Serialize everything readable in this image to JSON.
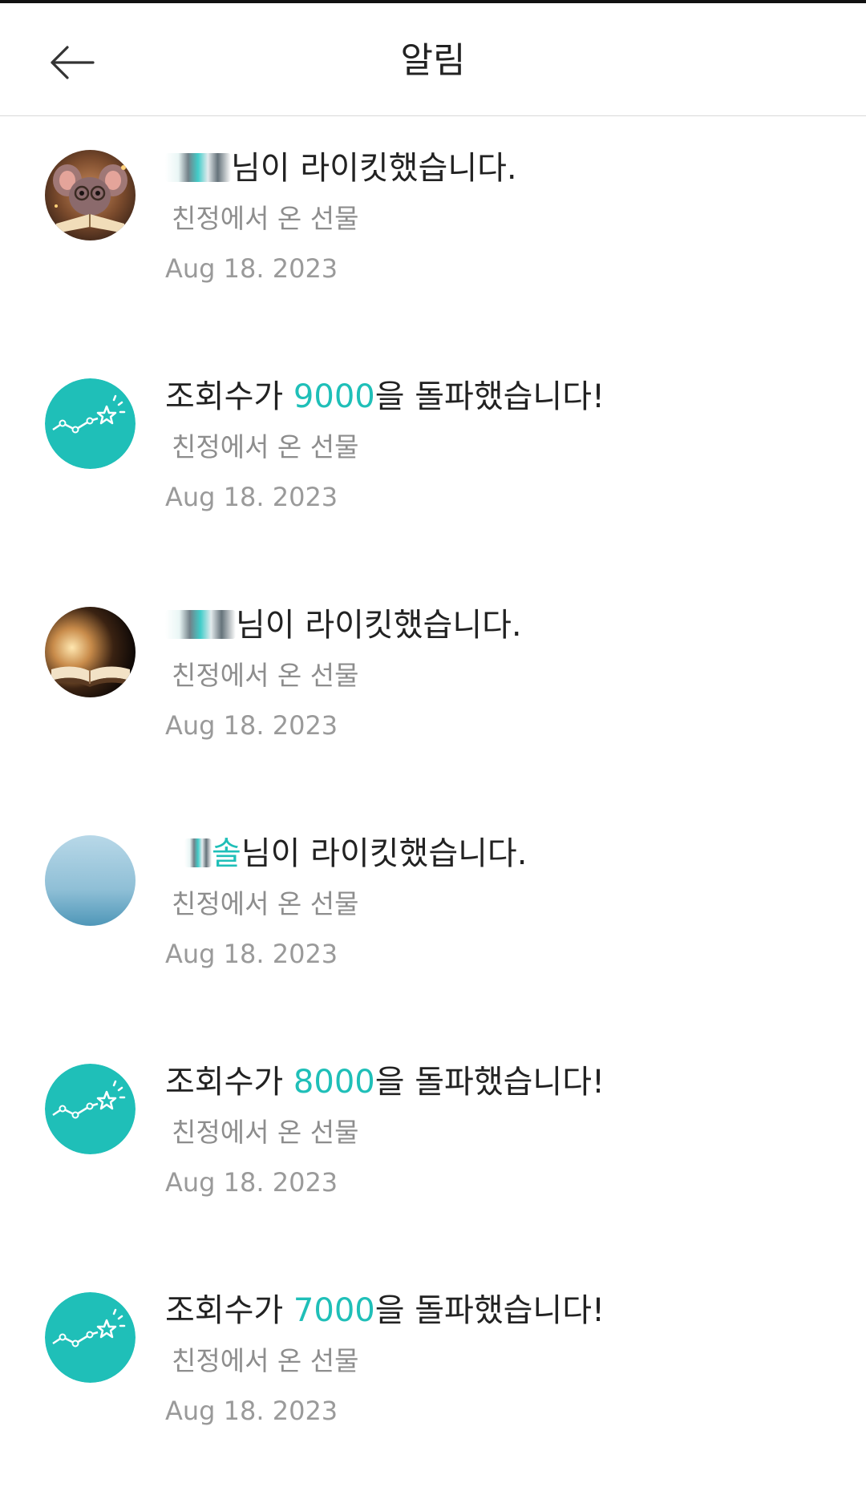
{
  "header": {
    "title": "알림",
    "back_icon": "arrow-left-icon"
  },
  "colors": {
    "accent": "#1fbfb8",
    "text": "#222222",
    "subtext": "#8d8d8d",
    "date": "#9a9a9a",
    "divider": "#d9d9d9"
  },
  "notifications": [
    {
      "type": "like",
      "avatar": "avatar-mouse-reading-icon",
      "user_name": "",
      "message": "님이 라이킷했습니다.",
      "source": "친정에서 온 선물",
      "date": "Aug 18. 2023"
    },
    {
      "type": "views",
      "avatar": "views-chart-icon",
      "prefix": "조회수가 ",
      "count": "9000",
      "suffix": "을 돌파했습니다!",
      "source": "친정에서 온 선물",
      "date": "Aug 18. 2023"
    },
    {
      "type": "like",
      "avatar": "avatar-open-book-icon",
      "user_name": "",
      "message": "님이 라이킷했습니다.",
      "source": "친정에서 온 선물",
      "date": "Aug 18. 2023"
    },
    {
      "type": "like",
      "avatar": "avatar-blue-gradient-icon",
      "user_name": "솔",
      "message": "님이 라이킷했습니다.",
      "source": "친정에서 온 선물",
      "date": "Aug 18. 2023"
    },
    {
      "type": "views",
      "avatar": "views-chart-icon",
      "prefix": "조회수가 ",
      "count": "8000",
      "suffix": "을 돌파했습니다!",
      "source": "친정에서 온 선물",
      "date": "Aug 18. 2023"
    },
    {
      "type": "views",
      "avatar": "views-chart-icon",
      "prefix": "조회수가 ",
      "count": "7000",
      "suffix": "을 돌파했습니다!",
      "source": "친정에서 온 선물",
      "date": "Aug 18. 2023"
    }
  ]
}
